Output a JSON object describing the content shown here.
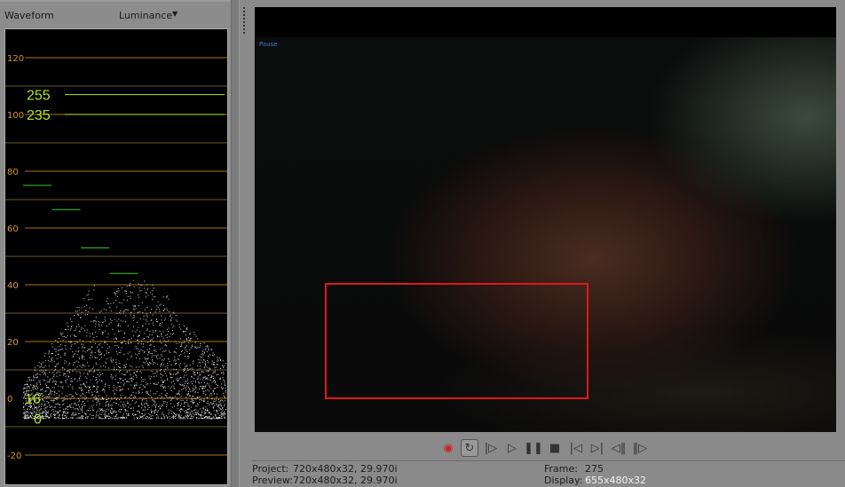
{
  "scope": {
    "title": "Waveform",
    "mode": "Luminance",
    "ticks": [
      {
        "v": 120,
        "label": "120"
      },
      {
        "v": 100,
        "label": "100"
      },
      {
        "v": 80,
        "label": "80"
      },
      {
        "v": 60,
        "label": "60"
      },
      {
        "v": 40,
        "label": "40"
      },
      {
        "v": 20,
        "label": "20"
      },
      {
        "v": 0,
        "label": "0"
      },
      {
        "v": -20,
        "label": "-20"
      }
    ],
    "markers": [
      {
        "label": "255",
        "v": 107
      },
      {
        "label": "235",
        "v": 100
      },
      {
        "label": "16",
        "v": 0
      },
      {
        "label": "0",
        "v": -7
      }
    ],
    "steps": [
      75,
      66.5,
      53,
      44
    ],
    "colors": {
      "tick": "#d49a1c",
      "marker": "#b4e61e"
    }
  },
  "viewer": {
    "overlay_text": "Pause"
  },
  "transport": [
    {
      "icon": "record-icon",
      "g": "◉"
    },
    {
      "icon": "loop-icon",
      "g": "↻"
    },
    {
      "icon": "play-from-start-icon",
      "g": "|▷"
    },
    {
      "icon": "play-icon",
      "g": "▷"
    },
    {
      "icon": "pause-icon",
      "g": "❚❚"
    },
    {
      "icon": "stop-icon",
      "g": "■"
    },
    {
      "icon": "previous-frame-icon",
      "g": "|◁"
    },
    {
      "icon": "next-frame-icon",
      "g": "▷|"
    },
    {
      "icon": "previous-marker-icon",
      "g": "◁‖"
    },
    {
      "icon": "next-marker-icon",
      "g": "‖▷"
    }
  ],
  "info": {
    "project_label": "Project:",
    "project_value": "720x480x32, 29.970i",
    "preview_label": "Preview:",
    "preview_value": "720x480x32, 29.970i",
    "frame_label": "Frame:",
    "frame_value": "275",
    "display_label": "Display:",
    "display_value": "655x480x32"
  }
}
